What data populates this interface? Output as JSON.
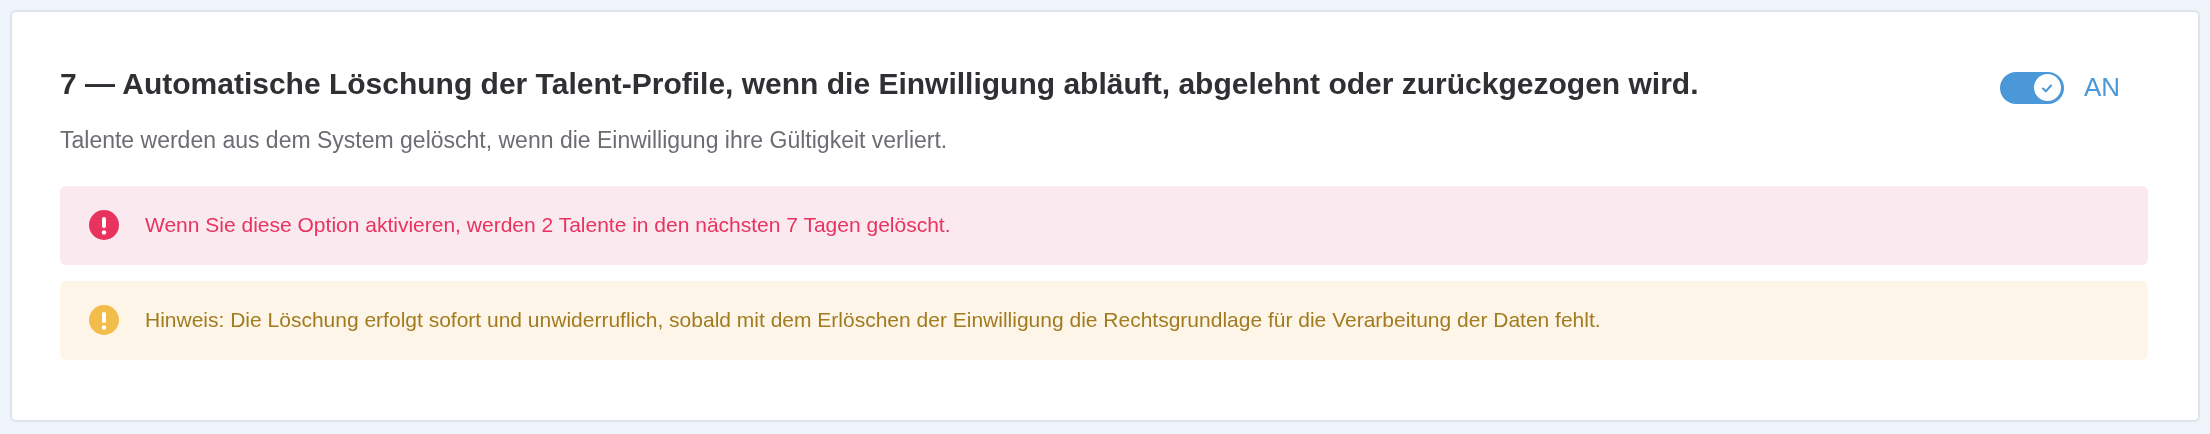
{
  "setting": {
    "title": "7 — Automatische Löschung der Talent-Profile, wenn die Einwilligung abläuft, abgelehnt oder zurückgezogen wird.",
    "toggle": {
      "on": true,
      "label": "AN"
    },
    "description": "Talente werden aus dem System gelöscht, wenn die Einwilligung ihre Gültigkeit verliert.",
    "alerts": [
      {
        "kind": "error",
        "text": "Wenn Sie diese Option aktivieren, werden 2 Talente in den nächsten 7 Tagen gelöscht."
      },
      {
        "kind": "warning",
        "text": "Hinweis: Die Löschung erfolgt sofort und unwiderruflich, sobald mit dem Erlöschen der Einwilligung die Rechtsgrundlage für die Verarbeitung der Daten fehlt."
      }
    ]
  }
}
